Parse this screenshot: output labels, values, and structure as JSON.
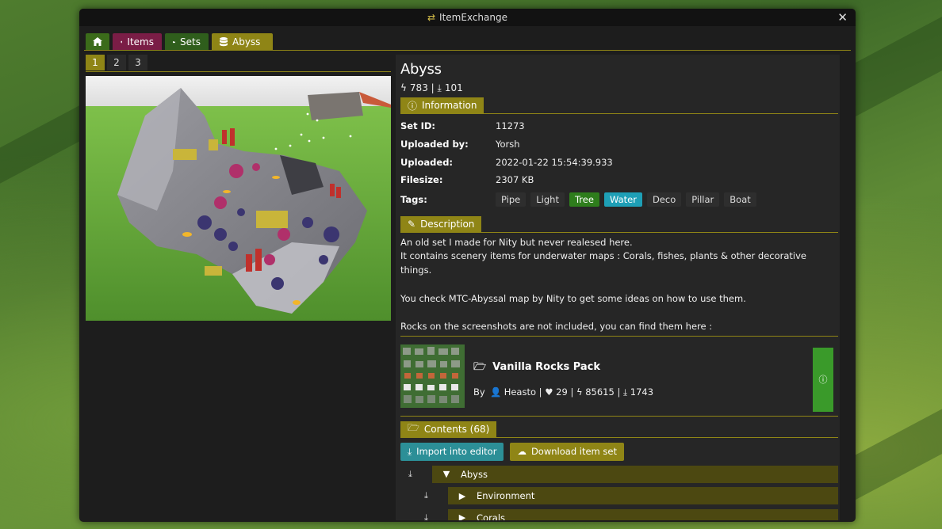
{
  "window": {
    "title": "ItemExchange"
  },
  "nav": {
    "home_icon": "home-icon",
    "tabs": [
      {
        "label": "Items",
        "icon": "tree-icon",
        "color": "#7a1d46"
      },
      {
        "label": "Sets",
        "icon": "folder-icon",
        "color": "#2f5e1c"
      },
      {
        "label": "Abyss",
        "icon": "database-icon",
        "color": "#8f8516"
      }
    ]
  },
  "image_tabs": [
    "1",
    "2",
    "3"
  ],
  "image_tabs_active": "1",
  "set": {
    "title": "Abyss",
    "stats": {
      "bolt": "783",
      "downloads": "101"
    }
  },
  "information": {
    "header": "Information",
    "rows": [
      {
        "key": "Set ID:",
        "value": "11273"
      },
      {
        "key": "Uploaded by:",
        "value": "Yorsh"
      },
      {
        "key": "Uploaded:",
        "value": "2022-01-22 15:54:39.933"
      },
      {
        "key": "Filesize:",
        "value": "2307 KB"
      }
    ],
    "tags_label": "Tags:",
    "tags": [
      {
        "label": "Pipe",
        "style": "plain"
      },
      {
        "label": "Light",
        "style": "plain"
      },
      {
        "label": "Tree",
        "style": "green"
      },
      {
        "label": "Water",
        "style": "cyan"
      },
      {
        "label": "Deco",
        "style": "plain"
      },
      {
        "label": "Pillar",
        "style": "plain"
      },
      {
        "label": "Boat",
        "style": "plain"
      }
    ]
  },
  "description": {
    "header": "Description",
    "lines": [
      "An old set I made for Nity but never realesed here.",
      "It contains scenery items for underwater maps : Corals, fishes, plants & other decorative things.",
      "",
      "You check MTC-Abyssal map by Nity to get some ideas on how to use them.",
      "",
      "Rocks on the screenshots are not included, you can find them here :"
    ]
  },
  "dependency": {
    "name": "Vanilla Rocks Pack",
    "by_label": "By",
    "author": "Heasto",
    "likes": "29",
    "bolt": "85615",
    "downloads": "1743"
  },
  "contents": {
    "header": "Contents (68)",
    "import_label": "Import into editor",
    "download_label": "Download item set",
    "tree": [
      {
        "label": "Abyss",
        "expanded": true,
        "depth": 0
      },
      {
        "label": "Environment",
        "expanded": false,
        "depth": 1
      },
      {
        "label": "Corals",
        "expanded": false,
        "depth": 1
      }
    ]
  },
  "colors": {
    "accent": "#8f8516",
    "items_tab": "#7a1d46",
    "sets_tab": "#2f5e1c",
    "tag_green": "#2e7d1c",
    "tag_cyan": "#1e9fb6",
    "import_button": "#2c8f97",
    "info_button": "#3a9a2a"
  }
}
